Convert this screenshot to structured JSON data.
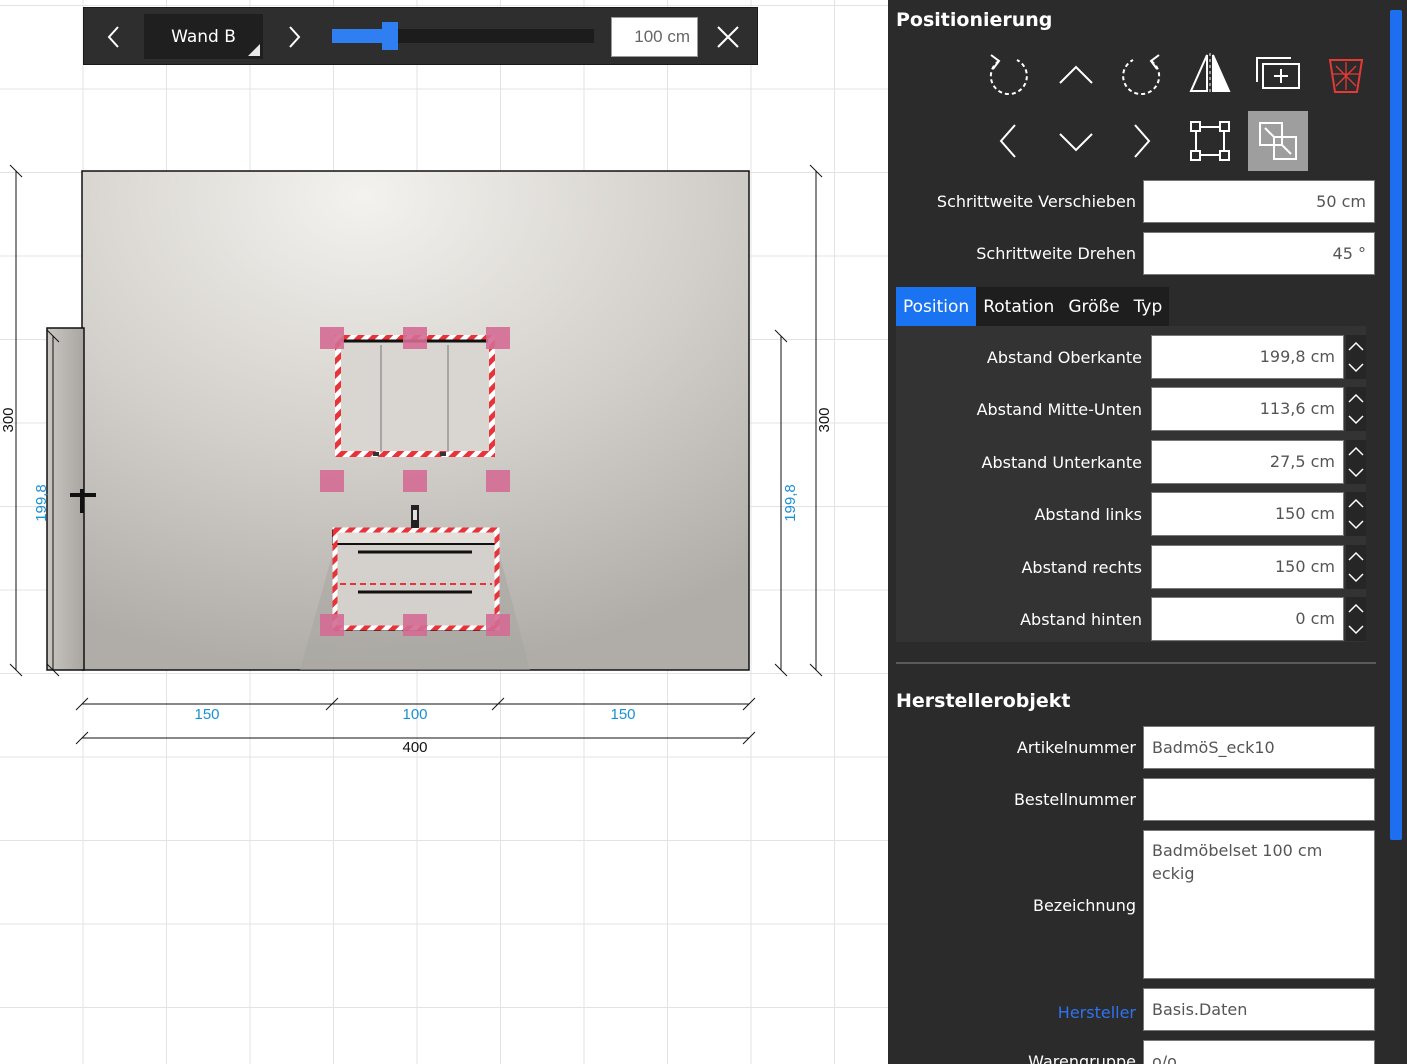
{
  "toolbar": {
    "prev_label": "previous-wall",
    "wall_name": "Wand B",
    "next_label": "next-wall",
    "zoom_level": 0.22,
    "width_value": "100 cm"
  },
  "drawing": {
    "height_left": "300",
    "height_right": "300",
    "object_height_left": "199,8",
    "object_height_right": "199,8",
    "dim_left": "150",
    "dim_middle": "100",
    "dim_right": "150",
    "total_width": "400",
    "colors": {
      "dimension_blue": "#1a8fd6",
      "selection_red": "#e8333a",
      "handle_pink": "#d46b93",
      "wall_gray": "#d6d3ce"
    }
  },
  "panel": {
    "positioning_title": "Positionierung",
    "icons_row1": [
      "rotate-left-icon",
      "move-up-icon",
      "rotate-right-icon",
      "mirror-icon",
      "duplicate-icon",
      "delete-icon"
    ],
    "icons_row2": [
      "move-left-icon",
      "move-down-icon",
      "move-right-icon",
      "select-resize-icon",
      "snap-fit-icon"
    ],
    "step_move_label": "Schrittweite Verschieben",
    "step_move_value": "50 cm",
    "step_rotate_label": "Schrittweite Drehen",
    "step_rotate_value": "45 °",
    "tabs": [
      "Position",
      "Rotation",
      "Größe",
      "Typ"
    ],
    "position_rows": [
      {
        "label": "Abstand Oberkante",
        "value": "199,8 cm"
      },
      {
        "label": "Abstand Mitte-Unten",
        "value": "113,6 cm"
      },
      {
        "label": "Abstand Unterkante",
        "value": "27,5 cm"
      },
      {
        "label": "Abstand links",
        "value": "150 cm"
      },
      {
        "label": "Abstand rechts",
        "value": "150 cm"
      },
      {
        "label": "Abstand hinten",
        "value": "0 cm"
      }
    ],
    "manufacturer_title": "Herstellerobjekt",
    "article_label": "Artikelnummer",
    "article_value": "BadmöS_eck10",
    "order_label": "Bestellnummer",
    "order_value": "",
    "name_label": "Bezeichnung",
    "name_value": "Badmöbelset 100 cm eckig",
    "maker_label": "Hersteller",
    "maker_value": "Basis.Daten",
    "group_label": "Warengruppe",
    "group_value": "o/o"
  }
}
